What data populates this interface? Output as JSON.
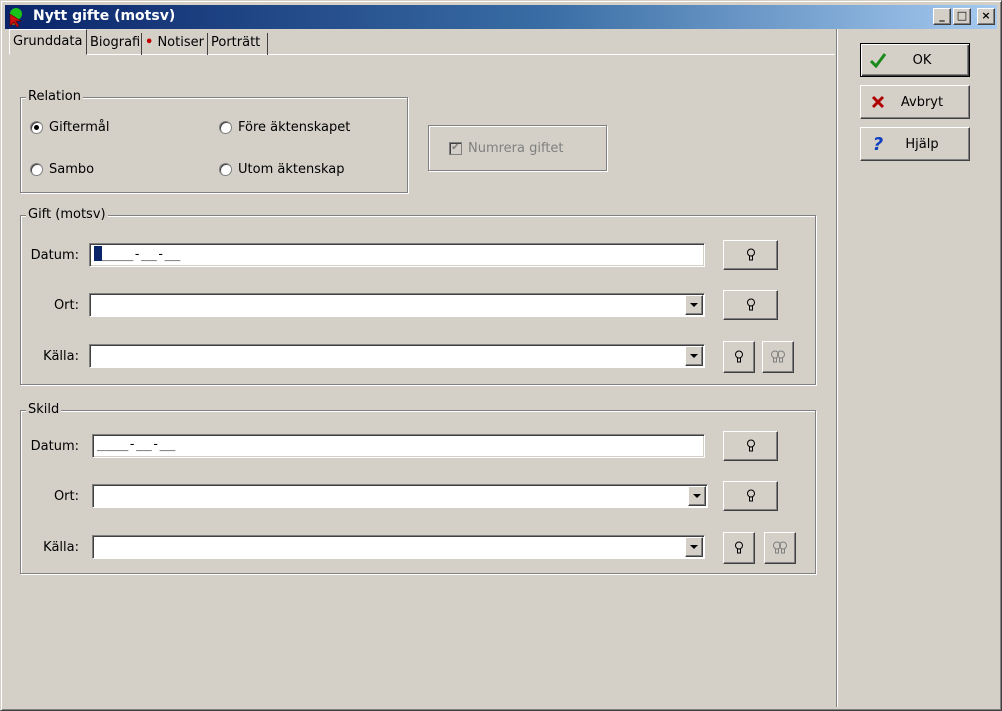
{
  "window": {
    "title": "Nytt gifte (motsv)",
    "controls": {
      "minimize": "_",
      "maximize": "□",
      "close": "×"
    }
  },
  "tabs": [
    {
      "label": "Grunddata",
      "active": true
    },
    {
      "label": "Biografi",
      "active": false
    },
    {
      "label": "Notiser",
      "active": false,
      "marker": "•"
    },
    {
      "label": "Porträtt",
      "active": false
    }
  ],
  "relation": {
    "legend": "Relation",
    "options": [
      {
        "label": "Giftermål",
        "checked": true
      },
      {
        "label": "Före äktenskapet",
        "checked": false
      },
      {
        "label": "Sambo",
        "checked": false
      },
      {
        "label": "Utom äktenskap",
        "checked": false
      }
    ]
  },
  "numrera": {
    "label": "Numrera giftet",
    "checked": true,
    "enabled": false
  },
  "gift": {
    "legend": "Gift (motsv)",
    "datum_label": "Datum:",
    "datum_value": "____-__-__",
    "ort_label": "Ort:",
    "ort_value": "",
    "kalla_label": "Källa:",
    "kalla_value": ""
  },
  "skild": {
    "legend": "Skild",
    "datum_label": "Datum:",
    "datum_value": "____-__-__",
    "ort_label": "Ort:",
    "ort_value": "",
    "kalla_label": "Källa:",
    "kalla_value": ""
  },
  "actions": {
    "ok": "OK",
    "cancel": "Avbryt",
    "help": "Hjälp"
  },
  "colors": {
    "title_gradient_start": "#0a246a",
    "title_gradient_end": "#a6caf0",
    "ok_check": "#1a8a1a",
    "cancel_x": "#b00000",
    "help_q": "#1040c0"
  }
}
